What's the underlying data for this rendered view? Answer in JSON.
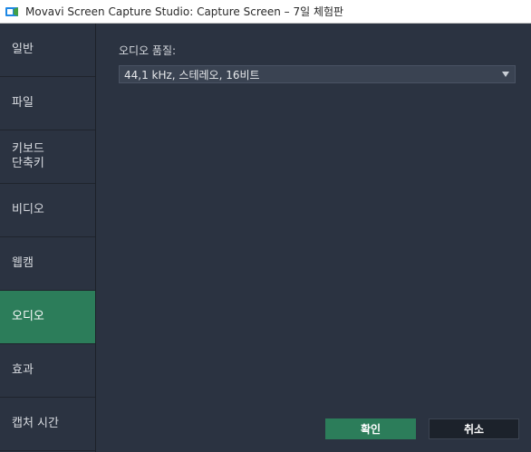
{
  "window": {
    "title": "Movavi Screen Capture Studio: Capture Screen – 7일 체험판",
    "app_icon": "movavi-app-icon"
  },
  "sidebar": {
    "items": [
      {
        "label": "일반"
      },
      {
        "label": "파일"
      },
      {
        "label": "키보드\n단축키"
      },
      {
        "label": "비디오"
      },
      {
        "label": "웹캠"
      },
      {
        "label": "오디오",
        "active": true
      },
      {
        "label": "효과"
      },
      {
        "label": "캡처 시간"
      }
    ]
  },
  "audio": {
    "quality_label": "오디오 품질:",
    "quality_value": "44,1 kHz, 스테레오, 16비트"
  },
  "buttons": {
    "ok_label": "확인",
    "cancel_label": "취소"
  },
  "colors": {
    "accent": "#2c7d5a",
    "background": "#2b3341"
  }
}
